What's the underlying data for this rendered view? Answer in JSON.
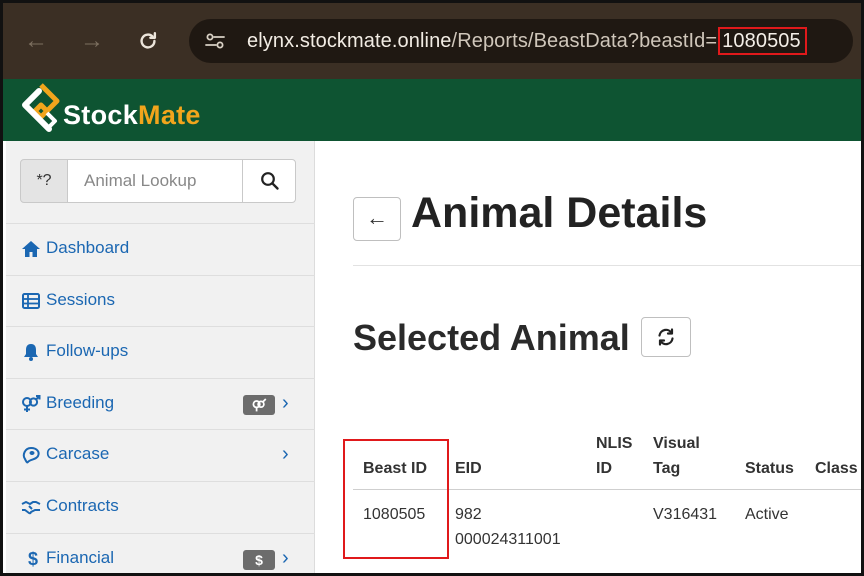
{
  "browser": {
    "url_host": "elynx.stockmate.online",
    "url_path": "/Reports/BeastData?beastId=",
    "url_highlighted": "1080505"
  },
  "app": {
    "logo_part1": "Stock",
    "logo_part2": "Mate",
    "brand_color": "#0e5432",
    "accent_color": "#f2a51c"
  },
  "sidebar": {
    "wildcard_label": "*?",
    "lookup_placeholder": "Animal Lookup",
    "items": [
      {
        "label": "Dashboard",
        "icon": "home-icon"
      },
      {
        "label": "Sessions",
        "icon": "table-list-icon"
      },
      {
        "label": "Follow-ups",
        "icon": "bell-icon"
      },
      {
        "label": "Breeding",
        "icon": "venus-mars-icon",
        "badge_icon": "venus-mars-icon"
      },
      {
        "label": "Carcase",
        "icon": "steak-icon"
      },
      {
        "label": "Contracts",
        "icon": "handshake-icon"
      },
      {
        "label": "Financial",
        "icon": "dollar-icon",
        "badge": "$"
      }
    ]
  },
  "main": {
    "page_title": "Animal Details",
    "section_title": "Selected Animal",
    "table": {
      "headers": [
        "Beast ID",
        "EID",
        "NLIS ID",
        "Visual Tag",
        "Status",
        "Class"
      ],
      "row": {
        "beast_id": "1080505",
        "eid_line1": "982",
        "eid_line2": "000024311001",
        "nlis_id": "",
        "visual_tag": "V316431",
        "status": "Active",
        "class": ""
      }
    }
  },
  "highlight_color": "#e0191b"
}
